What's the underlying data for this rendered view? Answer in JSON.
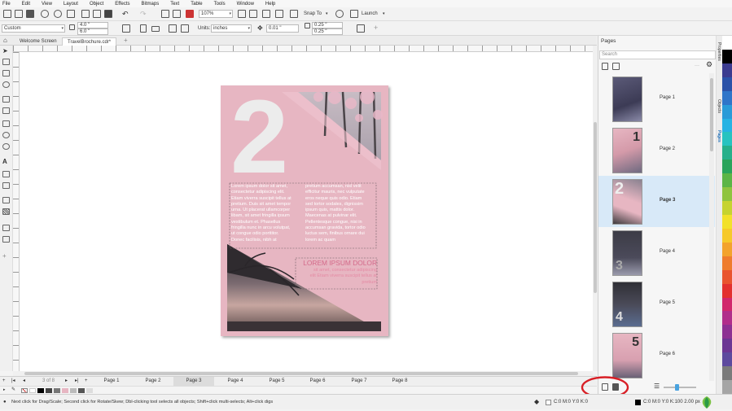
{
  "menu": [
    "File",
    "Edit",
    "View",
    "Layout",
    "Object",
    "Effects",
    "Bitmaps",
    "Text",
    "Table",
    "Tools",
    "Window",
    "Help"
  ],
  "toolbar": {
    "zoom": "107%",
    "snap_to": "Snap To",
    "launch": "Launch"
  },
  "propbar": {
    "preset": "Custom",
    "width": "4.0 \"",
    "height": "6.0 \"",
    "units_label": "Units:",
    "units": "inches",
    "nudge": "0.01 \"",
    "dup_x": "0.25 \"",
    "dup_y": "0.25 \""
  },
  "doc_tabs": [
    {
      "label": "Welcome Screen"
    },
    {
      "label": "TravelBrochure.cdr*"
    }
  ],
  "page_nav": {
    "counter": "3 of 8",
    "tabs": [
      "Page 1",
      "Page 2",
      "Page 3",
      "Page 4",
      "Page 5",
      "Page 6",
      "Page 7",
      "Page 8"
    ],
    "active": 2
  },
  "status": {
    "hint": "Next click for Drag/Scale; Second click for Rotate/Skew; Dbl-clicking tool selects all objects; Shift+click multi-selects; Alt+click digs",
    "fill": "C:0 M:0 Y:0 K:0",
    "outline": "C:0 M:0 Y:0 K:100  2.00 px"
  },
  "document": {
    "number": "2",
    "col1": "Lorem ipsum dolor sit amet,\nconsectetur adipiscing elit.\nEtiam viverra suscipit tellus at\npretium. Duis sit amet tempor\nurna. Ut placerat ullamcorper\nlibam, sit amet fringilla ipsum\nvestibulum et. Phasellus\nfringilla nunc in arcu volutpat,\nut congue odio porttitor.\nDonec facilisis, nibh at",
    "col2": "pretium accumsan, nisl velit\nefficitur mauris, nec vulputate\neros neque quis odio. Etiam\nsed tortor sodales, dignissim\nipsum quis, mattis dolor.\nMaecenas at pulvinar elit.\nPellentesque congue, nisi in\naccumsan gravida, tortor odio\nluctus sem, finibus ornare dui\nlorem ac quam",
    "heading": "LOREM IPSUM DOLOR",
    "subtext": "sit amet, consectetur adipiscing\nelit Etiam viverra suscipit tellus at\npretium"
  },
  "docker": {
    "title": "Pages",
    "search_placeholder": "Search",
    "pages": [
      {
        "label": "Page 1",
        "num": ""
      },
      {
        "label": "Page 2",
        "num": "1"
      },
      {
        "label": "Page 3",
        "num": "2"
      },
      {
        "label": "Page 4",
        "num": "3"
      },
      {
        "label": "Page 5",
        "num": "4"
      },
      {
        "label": "Page 6",
        "num": "5"
      }
    ],
    "selected": 2,
    "side_tabs": [
      "Properties",
      "Objects",
      "Pages"
    ],
    "zoom_value": "2.00 px"
  },
  "colors": {
    "brand_pink": "#e7b6c2",
    "dark_section": "#3e3a3e",
    "heading_pink": "#d46a8a",
    "annotation_red": "#d81f26",
    "selection_blue": "#d8e9f8"
  },
  "palette_colors": [
    "#ffffff",
    "#000000",
    "#3b3b8f",
    "#2b52a8",
    "#2f75c9",
    "#2a9bd8",
    "#27b3e3",
    "#28c3c0",
    "#27b08a",
    "#2aa45b",
    "#5cb546",
    "#8fc43f",
    "#c6d330",
    "#f2e12a",
    "#f6c92a",
    "#f3a32c",
    "#ef7c2d",
    "#e9542f",
    "#e3302f",
    "#d1276c",
    "#b12e8b",
    "#8d3193",
    "#6c3694",
    "#5d4a9e",
    "#7b7b7b",
    "#a5a5a5"
  ]
}
